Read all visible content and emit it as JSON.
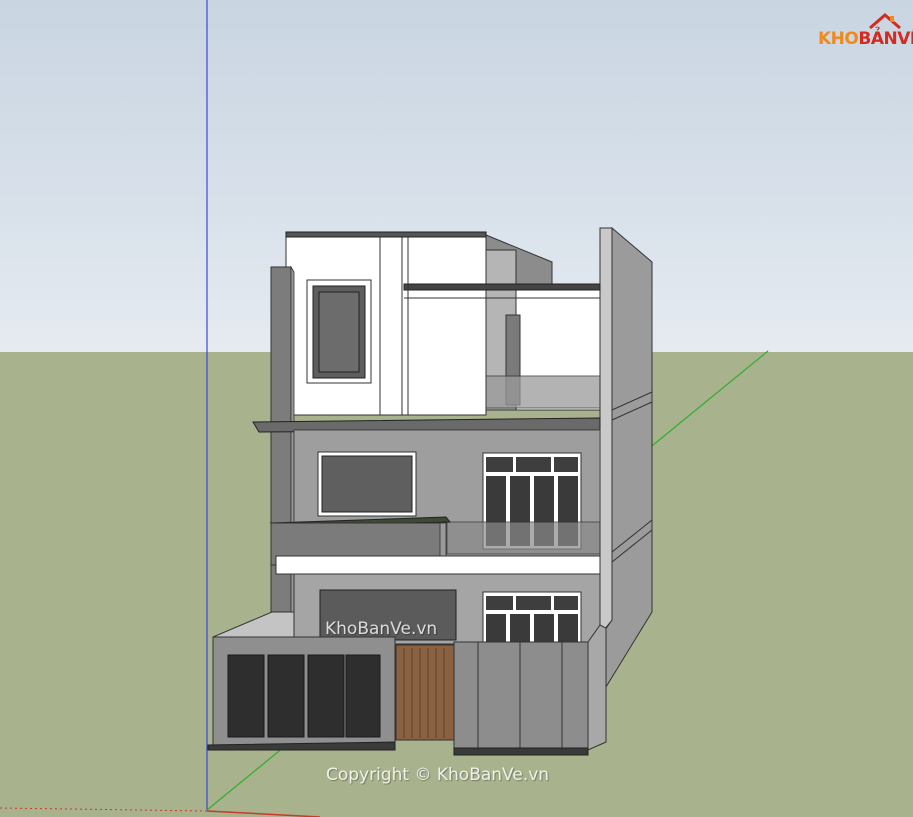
{
  "logo": {
    "kho": "KHO",
    "banve": "BẢNVẼ"
  },
  "watermark": "KhoBanVe.vn",
  "copyright": "Copyright © KhoBanVe.vn",
  "colors": {
    "sky": "#d7e0ea",
    "ground": "#a8b28c",
    "axis_blue": "#3b49d8",
    "axis_green": "#2fae2f",
    "axis_red": "#c83a2a",
    "logo_orange": "#f08a1c",
    "logo_red": "#d42a20"
  },
  "icons": {
    "logo": "house-roof-icon"
  }
}
